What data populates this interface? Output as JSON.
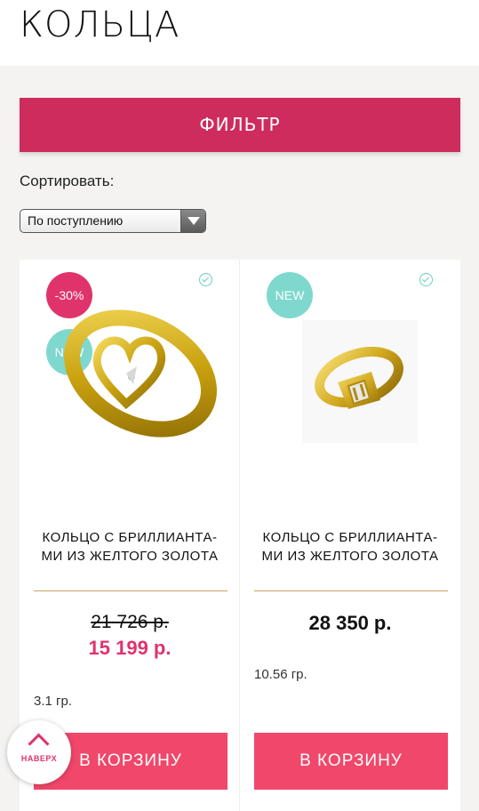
{
  "page": {
    "title": "КОЛЬЦА"
  },
  "filter": {
    "label": "ФИЛЬТР"
  },
  "sort": {
    "label": "Сортировать:",
    "selected": "По поступлению"
  },
  "products": [
    {
      "badges": [
        "-30%",
        "NEW"
      ],
      "name": "КОЛЬЦО С БРИЛЛИАНТА-МИ ИЗ ЖЕЛТОГО ЗОЛОТА",
      "old_price": "21 726 р.",
      "price": "15 199 р.",
      "weight": "3.1 гр.",
      "cart_label": "В КОРЗИНУ"
    },
    {
      "badges": [
        "NEW"
      ],
      "name": "КОЛЬЦО С БРИЛЛИАНТА-МИ ИЗ ЖЕЛТОГО ЗОЛОТА",
      "price": "28 350 р.",
      "weight": "10.56 гр.",
      "cart_label": "В КОРЗИНУ"
    }
  ],
  "back_to_top": {
    "label": "НАВЕРХ",
    "icon": "chevron-up-icon"
  },
  "colors": {
    "accent": "#cd2c5d",
    "cart": "#f0476a",
    "sale_badge": "#e0336b",
    "new_badge": "#7fd8ce",
    "divider": "#c9a35f"
  }
}
